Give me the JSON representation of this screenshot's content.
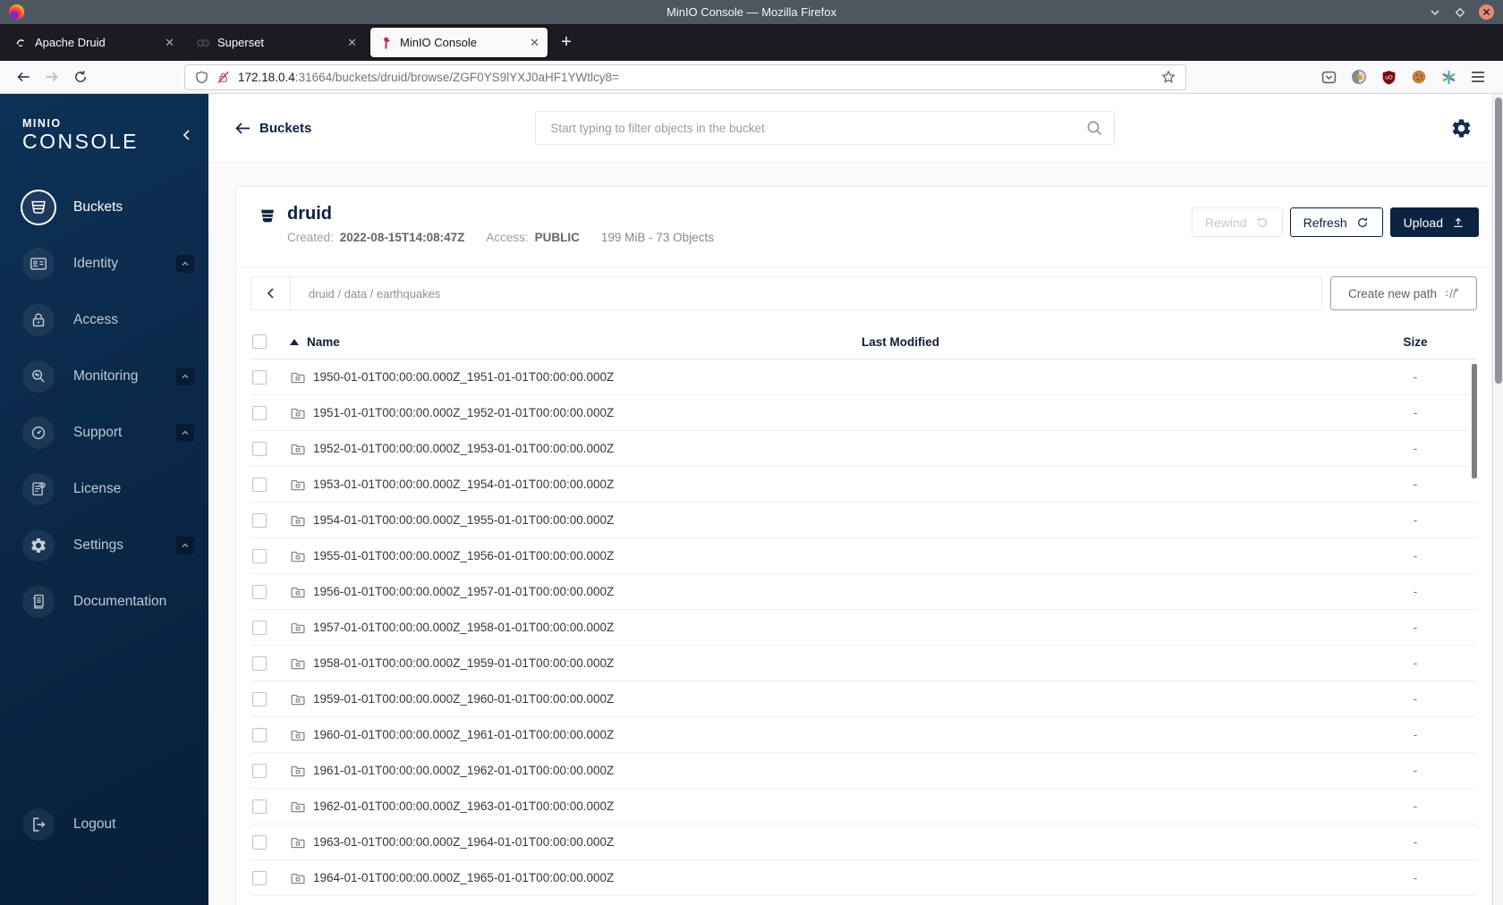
{
  "window": {
    "title": "MinIO Console — Mozilla Firefox"
  },
  "browser": {
    "tabs": [
      {
        "label": "Apache Druid",
        "icon": "druid-favicon",
        "active": false
      },
      {
        "label": "Superset",
        "icon": "superset-favicon",
        "active": false
      },
      {
        "label": "MinIO Console",
        "icon": "minio-flamingo-favicon",
        "active": true
      }
    ],
    "close_tab_label": "✕",
    "new_tab_label": "+",
    "url_host": "172.18.0.4",
    "url_rest": ":31664/buckets/druid/browse/ZGF0YS9lYXJ0aHF1YWtlcy8="
  },
  "sidebar": {
    "logo_line1": "MINIO",
    "logo_line2": "CONSOLE",
    "items": [
      {
        "label": "Buckets",
        "icon": "bucket-icon",
        "active": true,
        "expandable": false
      },
      {
        "label": "Identity",
        "icon": "id-card-icon",
        "active": false,
        "expandable": true
      },
      {
        "label": "Access",
        "icon": "lock-icon",
        "active": false,
        "expandable": false
      },
      {
        "label": "Monitoring",
        "icon": "magnifier-icon",
        "active": false,
        "expandable": true
      },
      {
        "label": "Support",
        "icon": "diagnostic-icon",
        "active": false,
        "expandable": true
      },
      {
        "label": "License",
        "icon": "license-icon",
        "active": false,
        "expandable": false
      },
      {
        "label": "Settings",
        "icon": "gear-icon",
        "active": false,
        "expandable": true
      },
      {
        "label": "Documentation",
        "icon": "docs-icon",
        "active": false,
        "expandable": false
      }
    ],
    "logout_label": "Logout"
  },
  "header": {
    "back_label": "Buckets",
    "search_placeholder": "Start typing to filter objects in the bucket"
  },
  "bucket": {
    "name": "druid",
    "created_label": "Created:",
    "created_value": "2022-08-15T14:08:47Z",
    "access_label": "Access:",
    "access_value": "PUBLIC",
    "summary": "199 MiB - 73 Objects",
    "actions": {
      "rewind": "Rewind",
      "refresh": "Refresh",
      "upload": "Upload"
    }
  },
  "browse": {
    "path_segments": [
      "druid",
      "data",
      "earthquakes"
    ],
    "create_path_label": "Create new path"
  },
  "table": {
    "columns": {
      "name": "Name",
      "last_modified": "Last Modified",
      "size": "Size"
    },
    "rows": [
      {
        "name": "1950-01-01T00:00:00.000Z_1951-01-01T00:00:00.000Z",
        "size": "-"
      },
      {
        "name": "1951-01-01T00:00:00.000Z_1952-01-01T00:00:00.000Z",
        "size": "-"
      },
      {
        "name": "1952-01-01T00:00:00.000Z_1953-01-01T00:00:00.000Z",
        "size": "-"
      },
      {
        "name": "1953-01-01T00:00:00.000Z_1954-01-01T00:00:00.000Z",
        "size": "-"
      },
      {
        "name": "1954-01-01T00:00:00.000Z_1955-01-01T00:00:00.000Z",
        "size": "-"
      },
      {
        "name": "1955-01-01T00:00:00.000Z_1956-01-01T00:00:00.000Z",
        "size": "-"
      },
      {
        "name": "1956-01-01T00:00:00.000Z_1957-01-01T00:00:00.000Z",
        "size": "-"
      },
      {
        "name": "1957-01-01T00:00:00.000Z_1958-01-01T00:00:00.000Z",
        "size": "-"
      },
      {
        "name": "1958-01-01T00:00:00.000Z_1959-01-01T00:00:00.000Z",
        "size": "-"
      },
      {
        "name": "1959-01-01T00:00:00.000Z_1960-01-01T00:00:00.000Z",
        "size": "-"
      },
      {
        "name": "1960-01-01T00:00:00.000Z_1961-01-01T00:00:00.000Z",
        "size": "-"
      },
      {
        "name": "1961-01-01T00:00:00.000Z_1962-01-01T00:00:00.000Z",
        "size": "-"
      },
      {
        "name": "1962-01-01T00:00:00.000Z_1963-01-01T00:00:00.000Z",
        "size": "-"
      },
      {
        "name": "1963-01-01T00:00:00.000Z_1964-01-01T00:00:00.000Z",
        "size": "-"
      },
      {
        "name": "1964-01-01T00:00:00.000Z_1965-01-01T00:00:00.000Z",
        "size": "-"
      }
    ]
  },
  "colors": {
    "brand_navy": "#081C42",
    "minio_red": "#C72C48",
    "titlebar_bg": "#4E575F",
    "tabbar_bg": "#1C1B22",
    "page_bg": "#FAFAFA",
    "sidebar_gradient_start": "#0D3156",
    "sidebar_gradient_end": "#071F3A"
  }
}
